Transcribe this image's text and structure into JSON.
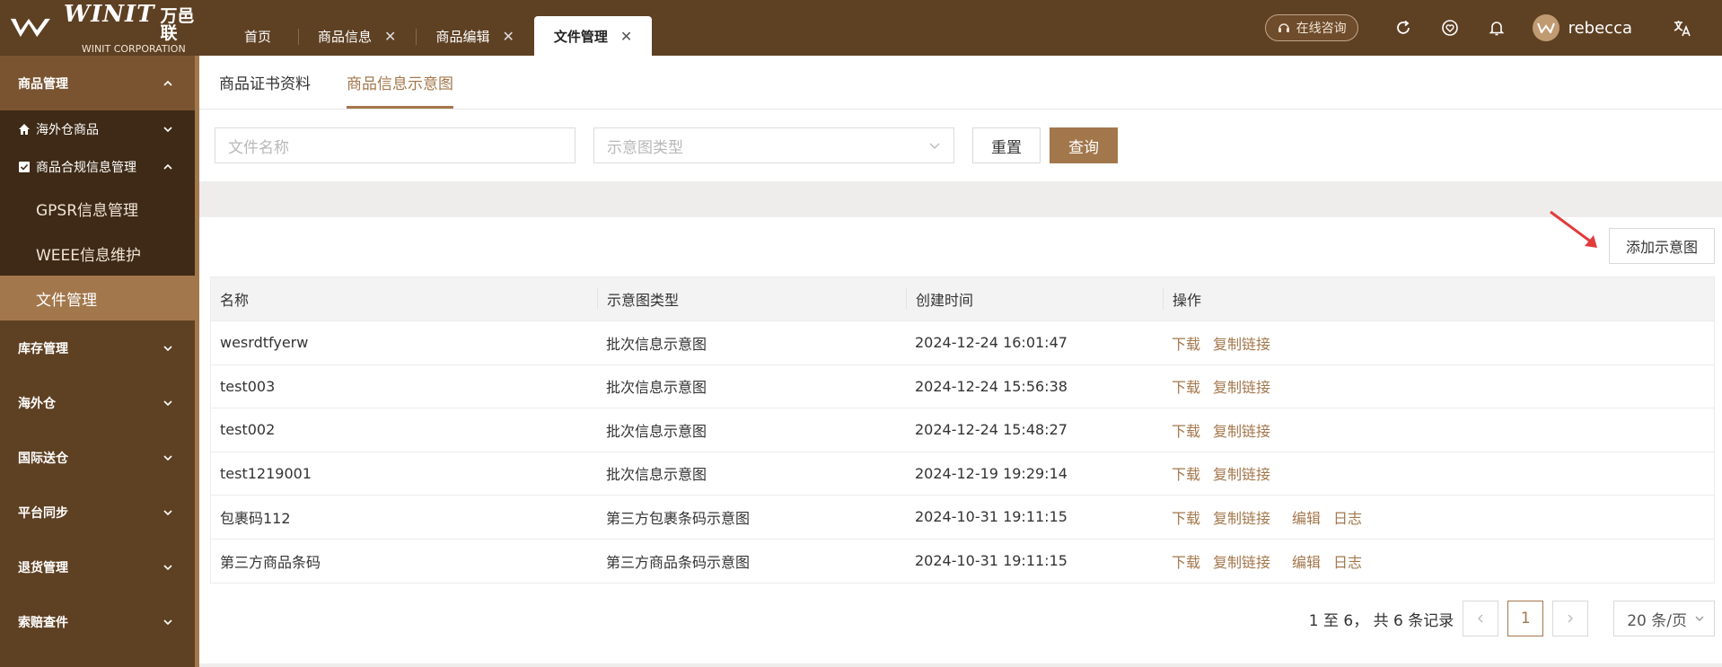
{
  "brand": {
    "logo_text": "WINIT",
    "logo_cn": "万邑联",
    "logo_sub": "WINIT CORPORATION"
  },
  "colors": {
    "brand_dark": "#5e4023",
    "accent": "#a3774c"
  },
  "tabs": [
    {
      "label": "首页",
      "closable": false
    },
    {
      "label": "商品信息",
      "closable": true
    },
    {
      "label": "商品编辑",
      "closable": true
    },
    {
      "label": "文件管理",
      "closable": true,
      "active": true
    }
  ],
  "topbar": {
    "consult_label": "在线咨询",
    "username": "rebecca"
  },
  "sidebar": {
    "group_goods": "商品管理",
    "item_overseas_goods": "海外仓商品",
    "item_compliance": "商品合规信息管理",
    "leaf_gpsr": "GPSR信息管理",
    "leaf_weee": "WEEE信息维护",
    "leaf_files": "文件管理",
    "groups": [
      "库存管理",
      "海外仓",
      "国际送仓",
      "平台同步",
      "退货管理",
      "索赔查件"
    ]
  },
  "subtabs": {
    "cert": "商品证书资料",
    "diagram": "商品信息示意图"
  },
  "filter": {
    "name_placeholder": "文件名称",
    "type_placeholder": "示意图类型",
    "reset": "重置",
    "query": "查询"
  },
  "add_button": "添加示意图",
  "table": {
    "headers": [
      "名称",
      "示意图类型",
      "创建时间",
      "操作"
    ],
    "rows": [
      {
        "name": "wesrdtfyerw",
        "type": "批次信息示意图",
        "time": "2024-12-24 16:01:47",
        "actions": [
          "下载",
          "复制链接"
        ]
      },
      {
        "name": "test003",
        "type": "批次信息示意图",
        "time": "2024-12-24 15:56:38",
        "actions": [
          "下载",
          "复制链接"
        ]
      },
      {
        "name": "test002",
        "type": "批次信息示意图",
        "time": "2024-12-24 15:48:27",
        "actions": [
          "下载",
          "复制链接"
        ]
      },
      {
        "name": "test1219001",
        "type": "批次信息示意图",
        "time": "2024-12-19 19:29:14",
        "actions": [
          "下载",
          "复制链接"
        ]
      },
      {
        "name": "包裹码112",
        "type": "第三方包裹条码示意图",
        "time": "2024-10-31 19:11:15",
        "actions": [
          "下载",
          "复制链接",
          "编辑",
          "日志"
        ]
      },
      {
        "name": "第三方商品条码",
        "type": "第三方商品条码示意图",
        "time": "2024-10-31 19:11:15",
        "actions": [
          "下载",
          "复制链接",
          "编辑",
          "日志"
        ]
      }
    ]
  },
  "pager": {
    "summary": "1 至 6， 共 6 条记录",
    "current": "1",
    "page_size": "20 条/页"
  }
}
